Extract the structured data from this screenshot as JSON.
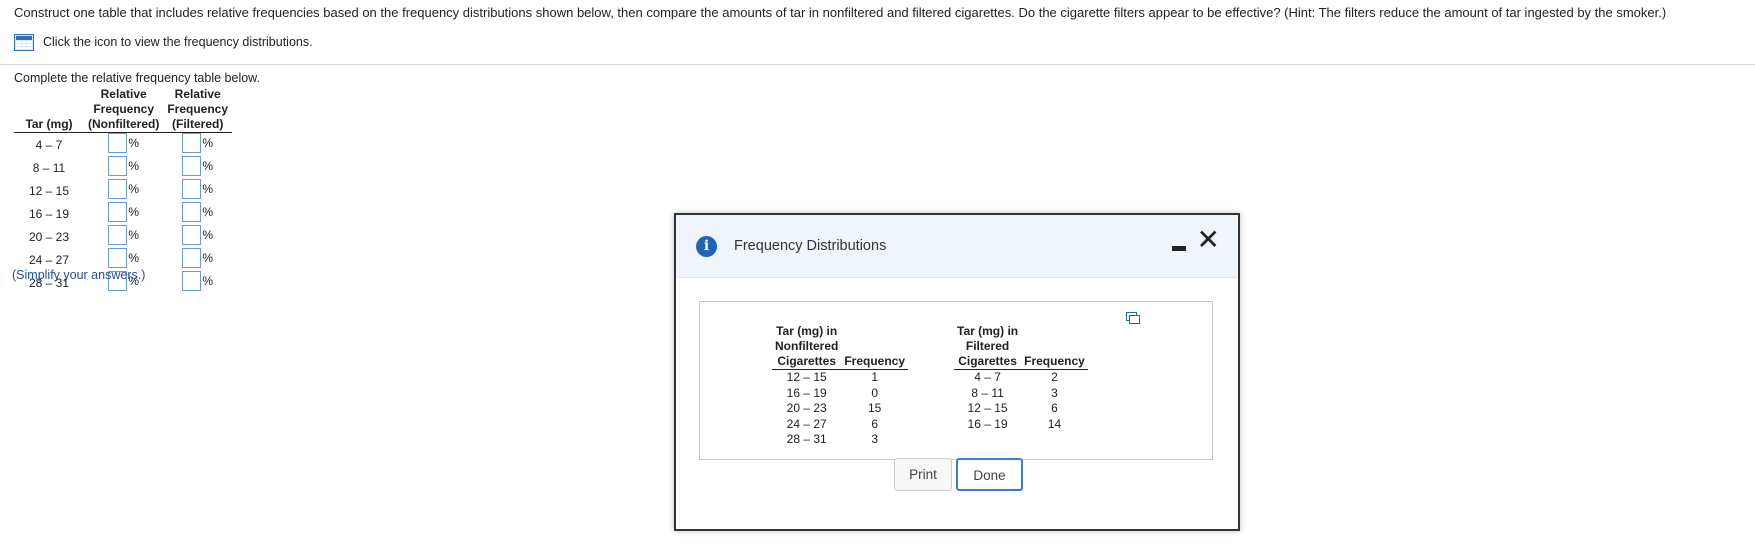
{
  "question": "Construct one table that includes relative frequencies based on the frequency distributions shown below, then compare the amounts of tar in nonfiltered and filtered cigarettes. Do the cigarette filters appear to be effective? (Hint: The filters reduce the amount of tar ingested by the smoker.)",
  "icon_link": "Click the icon to view the frequency distributions.",
  "complete_prompt": "Complete the relative frequency table below.",
  "rf_table": {
    "headers": {
      "tar_bottom": "Tar (mg)",
      "nonf_line1": "Relative",
      "nonf_line2": "Frequency",
      "nonf_line3": "(Nonfiltered)",
      "filt_line1": "Relative",
      "filt_line2": "Frequency",
      "filt_line3": "(Filtered)"
    },
    "percent_sign": "%",
    "rows": [
      {
        "tar": "4 – 7"
      },
      {
        "tar": "8 – 11"
      },
      {
        "tar": "12 – 15"
      },
      {
        "tar": "16 – 19"
      },
      {
        "tar": "20 – 23"
      },
      {
        "tar": "24 – 27"
      },
      {
        "tar": "28 – 31"
      }
    ]
  },
  "simplify": "(Simplify your answers.)",
  "dialog": {
    "title": "Frequency Distributions",
    "info_icon_glyph": "i",
    "close_glyph": "✕",
    "left_table": {
      "h1": "Tar (mg) in",
      "h2": "Nonfiltered",
      "h3": "Cigarettes",
      "freq_header": "Frequency",
      "rows": [
        {
          "range": "12 – 15",
          "freq": "1"
        },
        {
          "range": "16 – 19",
          "freq": "0"
        },
        {
          "range": "20 – 23",
          "freq": "15"
        },
        {
          "range": "24 – 27",
          "freq": "6"
        },
        {
          "range": "28 – 31",
          "freq": "3"
        }
      ]
    },
    "right_table": {
      "h1": "Tar (mg) in",
      "h2": "Filtered",
      "h3": "Cigarettes",
      "freq_header": "Frequency",
      "rows": [
        {
          "range": "4 – 7",
          "freq": "2"
        },
        {
          "range": "8 – 11",
          "freq": "3"
        },
        {
          "range": "12 – 15",
          "freq": "6"
        },
        {
          "range": "16 – 19",
          "freq": "14"
        }
      ]
    },
    "print_label": "Print",
    "done_label": "Done"
  }
}
